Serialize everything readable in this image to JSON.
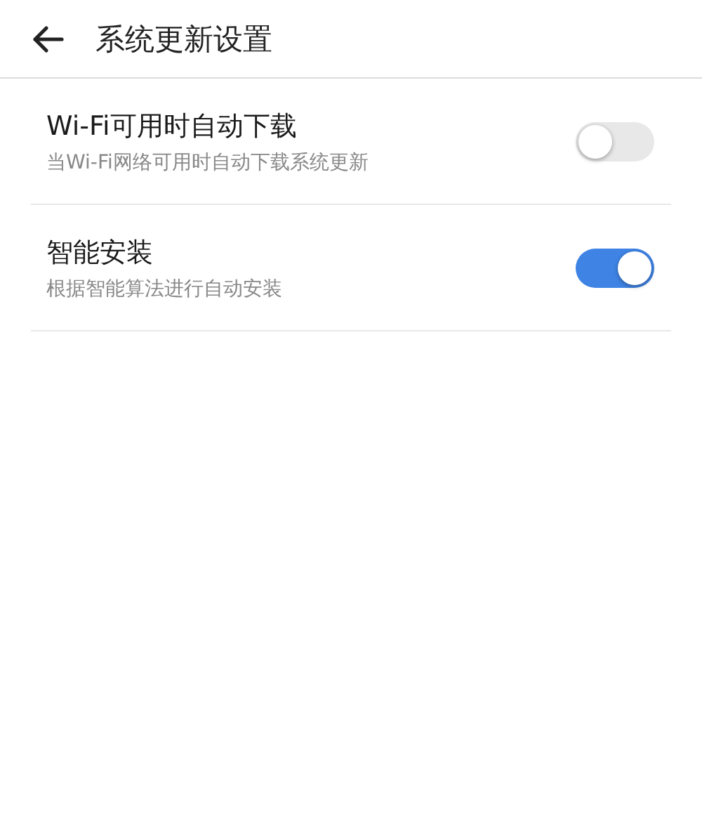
{
  "header": {
    "title": "系统更新设置"
  },
  "settings": [
    {
      "title": "Wi-Fi可用时自动下载",
      "subtitle": "当Wi-Fi网络可用时自动下载系统更新",
      "on": false
    },
    {
      "title": "智能安装",
      "subtitle": "根据智能算法进行自动安装",
      "on": true
    }
  ]
}
